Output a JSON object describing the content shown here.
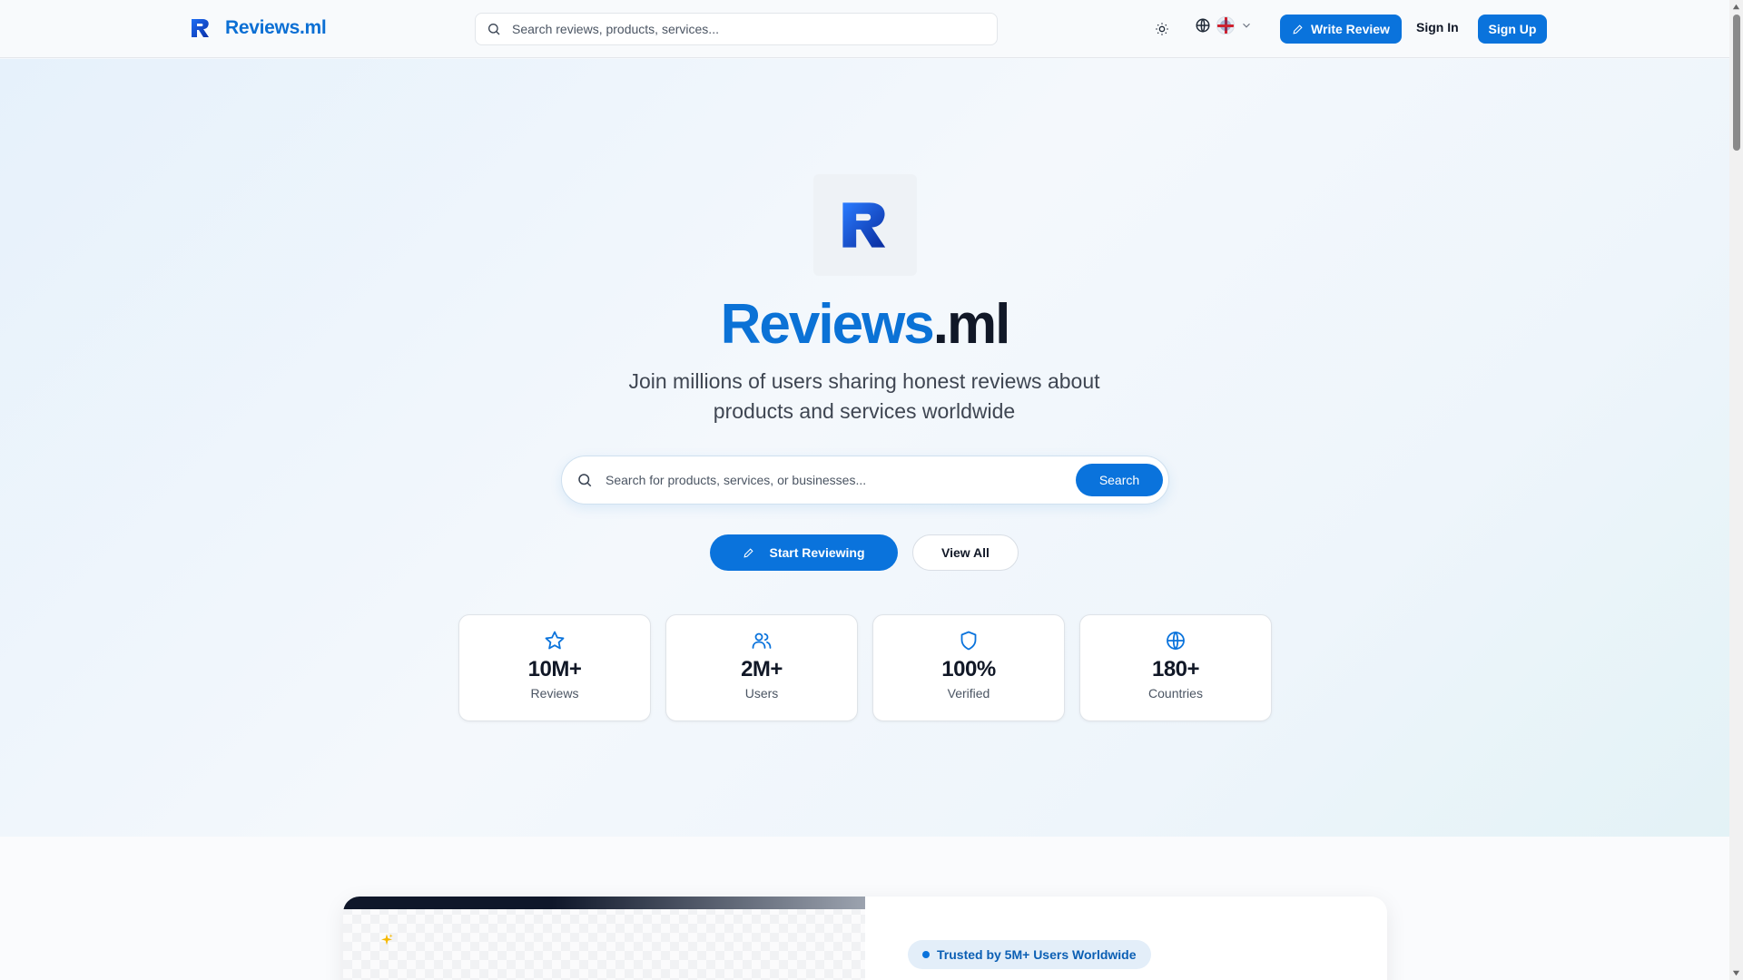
{
  "header": {
    "brand": "Reviews.ml",
    "search_placeholder": "Search reviews, products, services...",
    "write_review": "Write Review",
    "sign_in": "Sign In",
    "sign_up": "Sign Up",
    "icons": {
      "theme": "sun-icon",
      "language": "globe-icon",
      "flag": "uk-flag-icon",
      "dropdown": "chevron-down-icon"
    }
  },
  "hero": {
    "title_part1": "Reviews",
    "title_part2": ".ml",
    "subtitle": "Join millions of users sharing honest reviews about products and services worldwide",
    "search_placeholder": "Search for products, services, or businesses...",
    "search_button": "Search",
    "start_button": "Start Reviewing",
    "view_all_button": "View All"
  },
  "stats": [
    {
      "icon": "star-icon",
      "value": "10M+",
      "label": "Reviews"
    },
    {
      "icon": "users-icon",
      "value": "2M+",
      "label": "Users"
    },
    {
      "icon": "shield-icon",
      "value": "100%",
      "label": "Verified"
    },
    {
      "icon": "globe-icon",
      "value": "180+",
      "label": "Countries"
    }
  ],
  "feature": {
    "badge": "Trusted by 5M+ Users Worldwide",
    "icon": "sparkles-icon"
  },
  "colors": {
    "primary": "#0a73dc",
    "brand_text": "#0b72d6",
    "dark_text": "#111827"
  }
}
